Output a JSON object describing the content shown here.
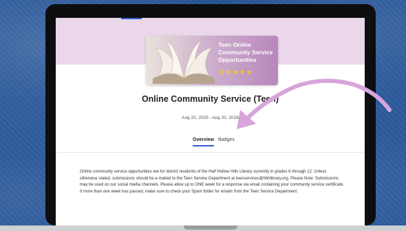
{
  "banner": {
    "text": "Teen Online Community Service Opportunities",
    "rating": "★★★★★"
  },
  "page": {
    "title": "Online Community Service (Teen)",
    "dates": "Aug 20, 2025 - Aug 20, 2026"
  },
  "tabs": [
    {
      "label": "Overview",
      "active": true
    },
    {
      "label": "Badges",
      "active": false
    }
  ],
  "overview": {
    "text": "Online community service opportunities are for district residents of the Half Hollow Hills Library currently in grades 6 through 12. Unless otherwise stated, submissions should be e-mailed to the Teen Service Department at teenservices@hhhlibrary.org. Please Note: Submissions may be used on our social media channels. Please allow up to ONE week for a response via email containing your community service certificate. If more than one week has passed, make sure to check your Spam folder for emails from the Teen Service Department."
  },
  "colors": {
    "accent": "#2d5fd3",
    "annotation_arrow": "#d7a4dc",
    "hero_band": "#ead8ea"
  }
}
